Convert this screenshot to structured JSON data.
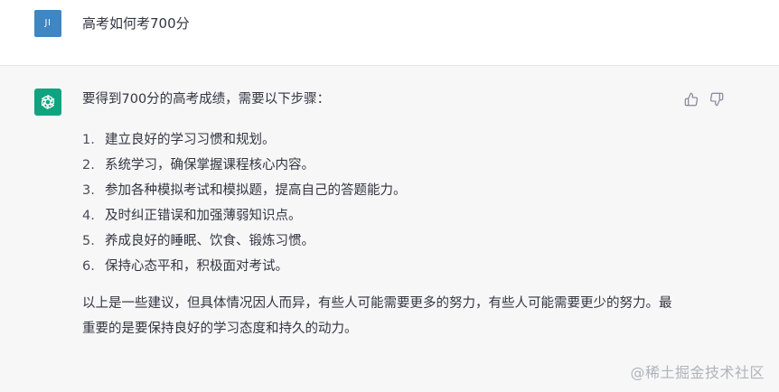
{
  "user": {
    "avatar_text": "JI",
    "avatar_color": "#3f86c3",
    "message": "高考如何考700分"
  },
  "assistant": {
    "avatar_icon": "openai-logo-icon",
    "avatar_color": "#10a37f",
    "intro": "要得到700分的高考成绩，需要以下步骤：",
    "steps": [
      {
        "num": "1.",
        "text": "建立良好的学习习惯和规划。"
      },
      {
        "num": "2.",
        "text": "系统学习，确保掌握课程核心内容。"
      },
      {
        "num": "3.",
        "text": "参加各种模拟考试和模拟题，提高自己的答题能力。"
      },
      {
        "num": "4.",
        "text": "及时纠正错误和加强薄弱知识点。"
      },
      {
        "num": "5.",
        "text": "养成良好的睡眠、饮食、锻炼习惯。"
      },
      {
        "num": "6.",
        "text": "保持心态平和，积极面对考试。"
      }
    ],
    "outro": "以上是一些建议，但具体情况因人而异，有些人可能需要更多的努力，有些人可能需要更少的努力。最重要的是要保持良好的学习态度和持久的动力。"
  },
  "feedback": {
    "thumbs_up_icon": "thumbs-up-icon",
    "thumbs_down_icon": "thumbs-down-icon"
  },
  "watermark": "@稀土掘金技术社区"
}
